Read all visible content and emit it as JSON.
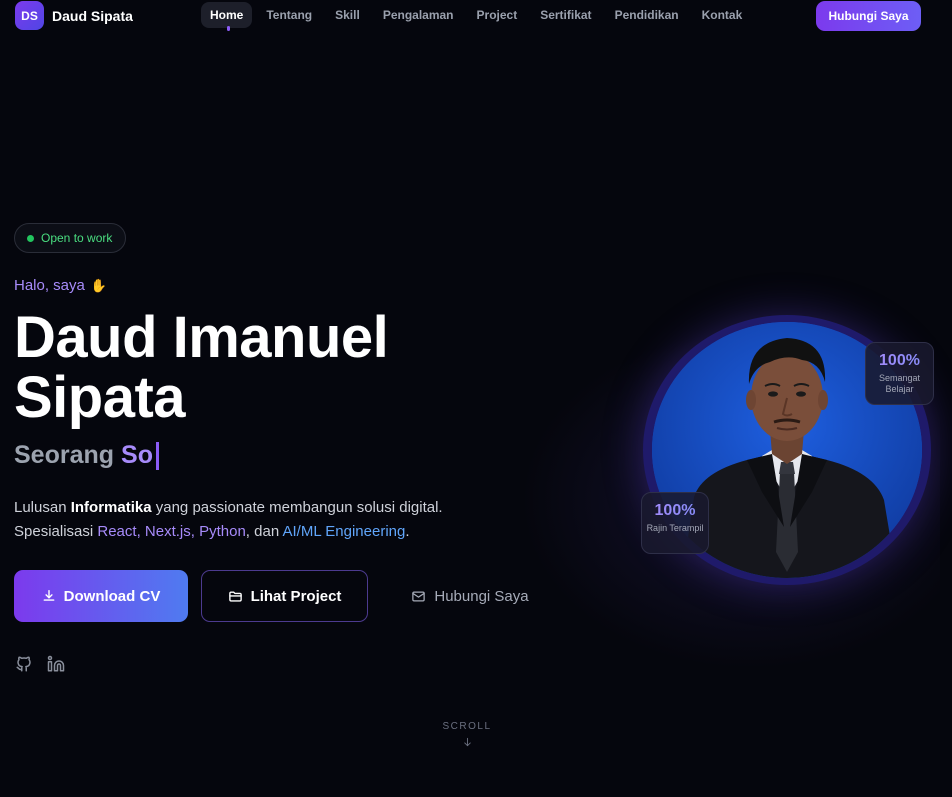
{
  "brand": {
    "initials": "DS",
    "name": "Daud Sipata"
  },
  "nav": {
    "links": [
      "Home",
      "Tentang",
      "Skill",
      "Pengalaman",
      "Project",
      "Sertifikat",
      "Pendidikan",
      "Kontak"
    ],
    "active": "Home",
    "cta": "Hubungi Saya"
  },
  "hero": {
    "status": "Open to work",
    "greeting": "Halo, saya",
    "name_line1": "Daud Imanuel",
    "name_line2": "Sipata",
    "role_prefix": "Seorang",
    "role_typed": "So",
    "description": {
      "line1_pre": "Lulusan ",
      "line1_bold": "Informatika",
      "line1_post": " yang passionate membangun solusi digital.",
      "line2_pre": "Spesialisasi ",
      "line2_react": "React",
      "sep1": ", ",
      "line2_next": "Next.js",
      "sep2": ", ",
      "line2_python": "Python",
      "line2_mid": ", dan ",
      "line2_ai": "AI/ML Engineering",
      "line2_end": "."
    },
    "buttons": {
      "download": "Download CV",
      "projects": "Lihat Project",
      "contact": "Hubungi Saya"
    },
    "socials": [
      "github-icon",
      "linkedin-icon"
    ],
    "scroll": "SCROLL"
  },
  "stats": {
    "top": {
      "value": "100%",
      "label": "Semangat Belajar"
    },
    "bottom": {
      "value": "100%",
      "label": "Rajin Terampil"
    }
  },
  "colors": {
    "background": "#05060d",
    "accent_purple": "#8b5cf6",
    "accent_blue": "#60a5fa",
    "status_green": "#22c55e"
  }
}
